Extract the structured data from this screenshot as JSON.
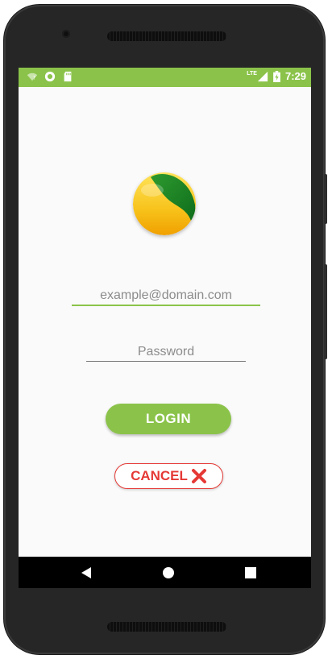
{
  "status_bar": {
    "time": "7:29",
    "network_label": "LTE",
    "icons": [
      "wifi-question-icon",
      "circle-notification-icon",
      "sd-card-icon",
      "signal-icon",
      "battery-charging-icon"
    ],
    "color": "#8bc34a"
  },
  "login": {
    "email_placeholder": "example@domain.com",
    "password_placeholder": "Password",
    "login_label": "LOGIN",
    "cancel_label": "CANCEL",
    "cancel_icon": "cross-icon",
    "accent": "#8bc34a",
    "cancel_color": "#e53935"
  },
  "nav_bar": {
    "buttons": [
      "back-icon",
      "home-icon",
      "recents-icon"
    ]
  }
}
